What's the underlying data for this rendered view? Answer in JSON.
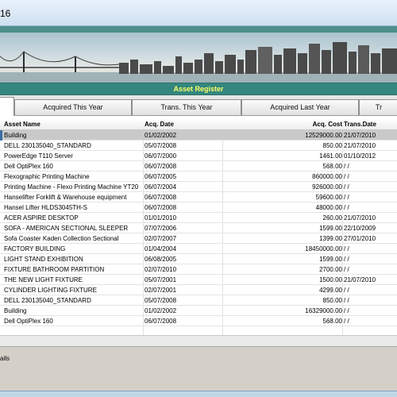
{
  "window": {
    "title": "16"
  },
  "banner": {
    "heading": "Asset Register"
  },
  "tabs": [
    {
      "label": ""
    },
    {
      "label": "Acquired This Year"
    },
    {
      "label": "Trans. This Year"
    },
    {
      "label": "Acquired Last Year"
    },
    {
      "label": "Tr"
    }
  ],
  "table": {
    "columns": {
      "asset_name": "Asset Name",
      "acq_date": "Acq. Date",
      "acq_cost": "Acq. Cost",
      "trans_date": "Trans.Date"
    },
    "rows": [
      {
        "name": "Building",
        "acq_date": "01/02/2002",
        "acq_cost": "12529000.00",
        "trans_date": "21/07/2010"
      },
      {
        "name": "DELL 230135040_STANDARD",
        "acq_date": "05/07/2008",
        "acq_cost": "850.00",
        "trans_date": "21/07/2010"
      },
      {
        "name": "PowerEdge T110 Server",
        "acq_date": "06/07/2000",
        "acq_cost": "1461.00",
        "trans_date": "01/10/2012"
      },
      {
        "name": "Dell OptiPlex 160",
        "acq_date": "06/07/2008",
        "acq_cost": "568.00",
        "trans_date": "/ /"
      },
      {
        "name": "Flexographic Printing Machine",
        "acq_date": "06/07/2005",
        "acq_cost": "860000.00",
        "trans_date": "/ /"
      },
      {
        "name": "Printing Machine - Flexo Printing Machine YT20",
        "acq_date": "06/07/2004",
        "acq_cost": "926000.00",
        "trans_date": "/ /"
      },
      {
        "name": "Hanselifter Forklift & Warehouse equipment",
        "acq_date": "06/07/2008",
        "acq_cost": "59600.00",
        "trans_date": "/ /"
      },
      {
        "name": "Hansel Lifter HLDS3045TH-S",
        "acq_date": "06/07/2008",
        "acq_cost": "48000.00",
        "trans_date": "/ /"
      },
      {
        "name": "ACER ASPIRE DESKTOP",
        "acq_date": "01/01/2010",
        "acq_cost": "260.00",
        "trans_date": "21/07/2010"
      },
      {
        "name": "SOFA - AMERICAN SECTIONAL SLEEPER",
        "acq_date": "07/07/2006",
        "acq_cost": "1599.00",
        "trans_date": "22/10/2009"
      },
      {
        "name": "Sofa Coaster Kaden Collection Sectional",
        "acq_date": "02/07/2007",
        "acq_cost": "1399.00",
        "trans_date": "27/01/2010"
      },
      {
        "name": "FACTORY BUILDING",
        "acq_date": "01/04/2004",
        "acq_cost": "18450000.00",
        "trans_date": "/ /"
      },
      {
        "name": "LIGHT STAND EXHIBITION",
        "acq_date": "06/08/2005",
        "acq_cost": "1599.00",
        "trans_date": "/ /"
      },
      {
        "name": "FIXTURE BATHROOM PARTITION",
        "acq_date": "02/07/2010",
        "acq_cost": "2700.00",
        "trans_date": "/ /"
      },
      {
        "name": "THE NEW LIGHT FIXTURE",
        "acq_date": "05/07/2001",
        "acq_cost": "1500.00",
        "trans_date": "21/07/2010"
      },
      {
        "name": "CYLINDER LIGHTING FIXTURE",
        "acq_date": "02/07/2001",
        "acq_cost": "4299.00",
        "trans_date": "/ /"
      },
      {
        "name": "DELL 230135040_STANDARD",
        "acq_date": "05/07/2008",
        "acq_cost": "850.00",
        "trans_date": "/ /"
      },
      {
        "name": "Building",
        "acq_date": "01/02/2002",
        "acq_cost": "16329000.00",
        "trans_date": "/ /"
      },
      {
        "name": "Dell OptiPlex 160",
        "acq_date": "06/07/2008",
        "acq_cost": "568.00",
        "trans_date": "/ /"
      }
    ]
  },
  "status": {
    "text": "ails"
  },
  "colors": {
    "teal": "#33877f",
    "banner_text": "#ffff66",
    "selected_row": "#c9c9c9"
  },
  "icons": {
    "banner": "city-skyline-image"
  }
}
